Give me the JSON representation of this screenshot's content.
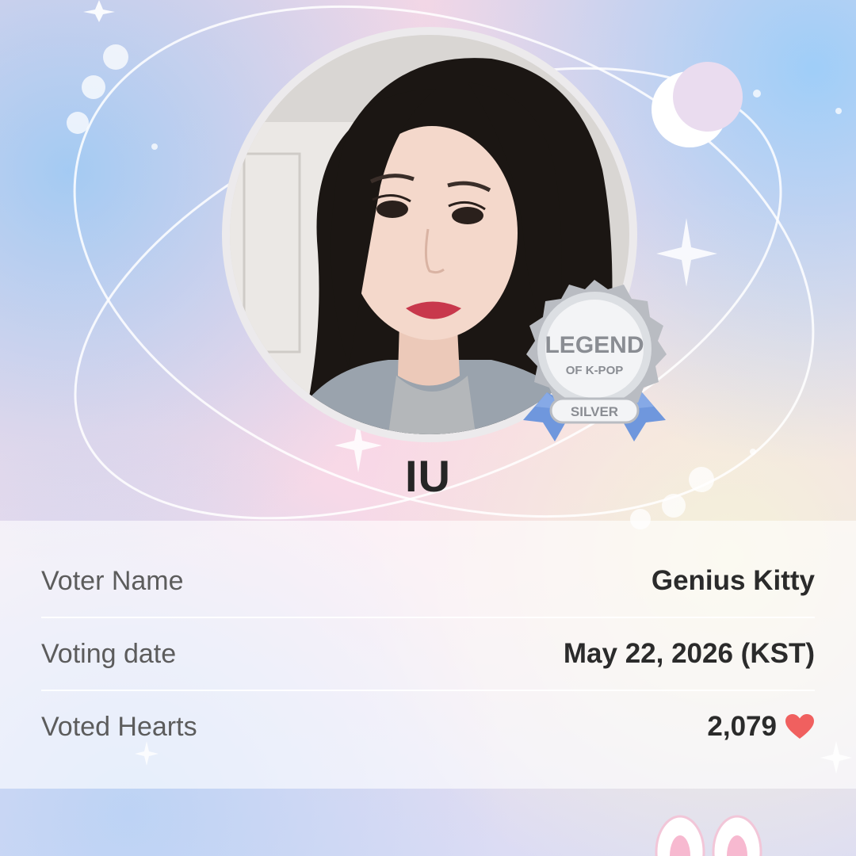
{
  "idol": {
    "name": "IU"
  },
  "badge": {
    "line1": "LEGEND",
    "line2": "OF K-POP",
    "tier": "SILVER",
    "ribbon_color": "#6f97dd"
  },
  "details": [
    {
      "label": "Voter Name",
      "value": "Genius Kitty"
    },
    {
      "label": "Voting date",
      "value": "May 22, 2026 (KST)"
    },
    {
      "label": "Voted Hearts",
      "value": "2,079",
      "icon": "heart-icon",
      "icon_color": "#f0605f"
    }
  ]
}
